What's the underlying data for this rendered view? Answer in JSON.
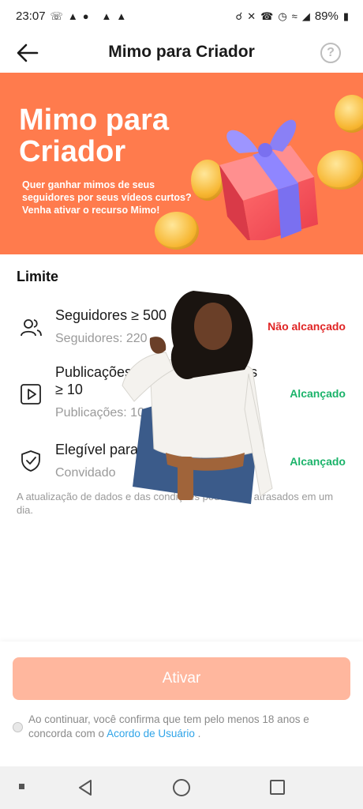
{
  "status_bar": {
    "time": "23:07",
    "battery": "89%",
    "left_icons": [
      "whatsapp-icon",
      "alert-icon",
      "messenger-icon",
      "alert-icon",
      "alert-icon"
    ],
    "right_icons": [
      "headphones-icon",
      "mute-icon",
      "wifi-call-icon",
      "alarm-icon",
      "wifi-icon",
      "signal-icon",
      "battery-icon"
    ]
  },
  "header": {
    "title": "Mimo para Criador",
    "back_icon": "arrow-left-icon",
    "help_label": "?"
  },
  "banner": {
    "title": "Mimo para Criador",
    "subtitle": "Quer ganhar mimos de seus seguidores por seus vídeos curtos? Venha ativar o recurso Mimo!",
    "bg_color": "#ff7b4d"
  },
  "limits": {
    "section_title": "Limite",
    "items": [
      {
        "icon": "users-icon",
        "title": "Seguidores ≥ 500",
        "subtitle": "Seguidores: 220",
        "status": "Não alcançado",
        "met": false
      },
      {
        "icon": "video-play-icon",
        "title": "Publicações nos últimos 30 dias ≥ 10",
        "subtitle": "Publicações: 10",
        "status": "Alcançado",
        "met": true
      },
      {
        "icon": "shield-check-icon",
        "title": "Elegível para teste",
        "subtitle": "Convidado",
        "status": "Alcançado",
        "met": true
      }
    ],
    "note": "A atualização de dados e das condições podem ser atrasados em um dia."
  },
  "action": {
    "button_label": "Ativar",
    "button_color": "#ffb79e",
    "consent_prefix": "Ao continuar, você confirma que tem pelo menos 18 anos e concorda com o",
    "consent_link": "Acordo de Usuário",
    "consent_suffix": "."
  },
  "nav_bar": {
    "icons": [
      "overview-dot-icon",
      "back-triangle-icon",
      "home-circle-icon",
      "recents-square-icon"
    ]
  }
}
